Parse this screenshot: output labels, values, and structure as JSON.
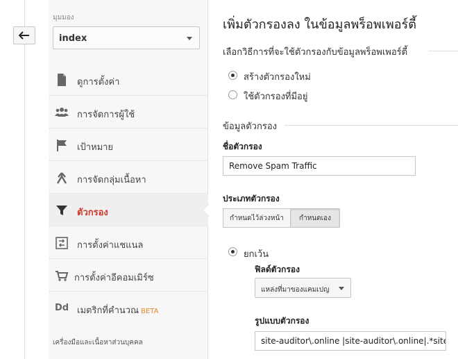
{
  "sidebar": {
    "view_label": "มุมมอง",
    "view_value": "index",
    "items": [
      {
        "label": "ดูการตั้งค่า",
        "icon": "document-icon"
      },
      {
        "label": "การจัดการผู้ใช้",
        "icon": "users-icon"
      },
      {
        "label": "เป้าหมาย",
        "icon": "flag-icon"
      },
      {
        "label": "การจัดกลุ่มเนื้อหา",
        "icon": "content-grouping-icon"
      },
      {
        "label": "ตัวกรอง",
        "icon": "filter-icon"
      },
      {
        "label": "การตั้งค่าแชแนล",
        "icon": "channel-settings-icon"
      },
      {
        "label": "การตั้งค่าอีคอมเมิร์ซ",
        "icon": "cart-icon"
      },
      {
        "label": "เมตริกที่คำนวณ",
        "badge": "BETA",
        "icon": "calculated-metrics-icon"
      }
    ],
    "footer": "เครื่องมือและเนื้อหาส่วนบุคคล"
  },
  "main": {
    "title": "เพิ่มตัวกรองลง ในข้อมูลพร็อพเพอร์ตี้",
    "method_heading": "เลือกวิธีการที่จะใช้ตัวกรองกับข้อมูลพร็อพเพอร์ตี้",
    "radio_new": "สร้างตัวกรองใหม่",
    "radio_existing": "ใช้ตัวกรองที่มีอยู่",
    "info_heading": "ข้อมูลตัวกรอง",
    "name_label": "ชื่อตัวกรอง",
    "name_value": "Remove Spam Traffic",
    "type_label": "ประเภทตัวกรอง",
    "type_predefined": "กำหนดไว้ล่วงหน้า",
    "type_custom": "กำหนดเอง",
    "exclude_label": "ยกเว้น",
    "field_label": "ฟิลด์ตัวกรอง",
    "field_value": "แหล่งที่มาของแคมเปญ",
    "pattern_label": "รูปแบบตัวกรอง",
    "pattern_value": "site-auditor\\.online |site-auditor\\.online|.*site-auditor"
  }
}
